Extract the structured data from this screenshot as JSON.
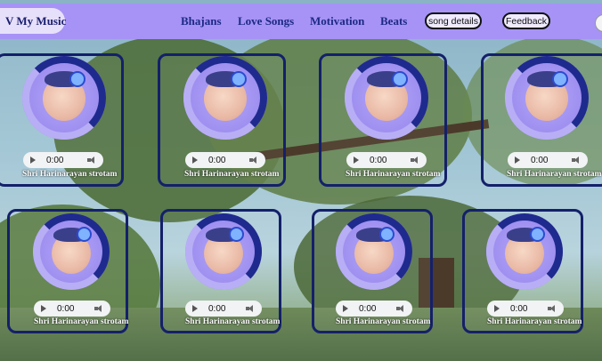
{
  "brand": {
    "title": "V My Music"
  },
  "nav": {
    "links": [
      "Bhajans",
      "Love Songs",
      "Motivation",
      "Beats"
    ],
    "song_details": "song details",
    "feedback": "Feedback"
  },
  "player": {
    "time": "0:00"
  },
  "songs": [
    {
      "title": "Shri Harinarayan strotam"
    },
    {
      "title": "Shri Harinarayan strotam"
    },
    {
      "title": "Shri Harinarayan strotam"
    },
    {
      "title": "Shri Harinarayan strotam"
    },
    {
      "title": "Shri Harinarayan strotam"
    },
    {
      "title": "Shri Harinarayan strotam"
    },
    {
      "title": "Shri Harinarayan strotam"
    },
    {
      "title": "Shri Harinarayan strotam"
    }
  ],
  "colors": {
    "navbar": "#a693f5",
    "brand_bg": "#e7e0fb",
    "nav_text": "#1d2a86",
    "card_border": "#14206a"
  }
}
